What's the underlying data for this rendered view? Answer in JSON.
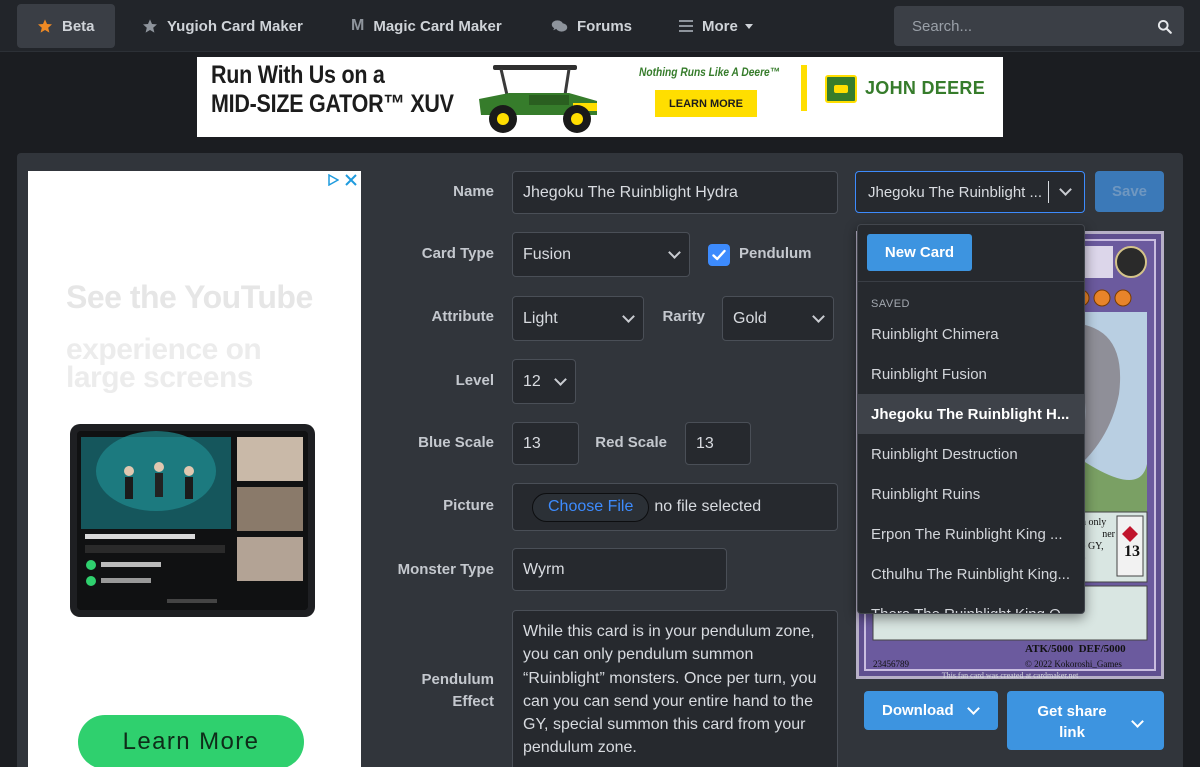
{
  "nav": {
    "items": [
      {
        "label": "Beta",
        "icon": "star-icon"
      },
      {
        "label": "Yugioh Card Maker",
        "icon": "star-icon"
      },
      {
        "label": "Magic Card Maker",
        "icon_glyph": "M"
      },
      {
        "label": "Forums",
        "icon": "comments-icon"
      },
      {
        "label": "More",
        "icon": "hamburger-icon"
      }
    ],
    "search_placeholder": "Search..."
  },
  "banner": {
    "headline_1": "Run With Us on a",
    "headline_2": "MID-SIZE GATOR™ XUV",
    "tagline": "Nothing Runs Like A Deere™",
    "cta": "LEARN MORE",
    "brand": "JOHN DEERE"
  },
  "side_ad": {
    "title_1": "See the YouTube",
    "title_2": "experience on large screens",
    "cta": "Learn More"
  },
  "form": {
    "name_label": "Name",
    "name_value": "Jhegoku The Ruinblight Hydra",
    "card_type_label": "Card Type",
    "card_type_value": "Fusion",
    "pendulum_label": "Pendulum",
    "attribute_label": "Attribute",
    "attribute_value": "Light",
    "rarity_label": "Rarity",
    "rarity_value": "Gold",
    "level_label": "Level",
    "level_value": "12",
    "blue_scale_label": "Blue Scale",
    "blue_scale_value": "13",
    "red_scale_label": "Red Scale",
    "red_scale_value": "13",
    "picture_label": "Picture",
    "choose_file": "Choose File",
    "no_file": "no file selected",
    "monster_type_label": "Monster Type",
    "monster_type_value": "Wyrm",
    "pendulum_effect_label_1": "Pendulum",
    "pendulum_effect_label_2": "Effect",
    "pendulum_effect_value": "While this card is in your pendulum zone, you can only pendulum summon “Ruinblight” monsters. Once per turn, you can you can send your entire hand to the GY, special summon this card from your pendulum zone."
  },
  "card_picker": {
    "selected": "Jhegoku The Ruinblight ...",
    "save_label": "Save",
    "new_card_label": "New Card",
    "saved_header": "SAVED",
    "saved_items": [
      "Ruinblight Chimera",
      "Ruinblight Fusion",
      "Jhegoku The Ruinblight H...",
      "Ruinblight Destruction",
      "Ruinblight Ruins",
      "Erpon The Ruinblight King ...",
      "Cthulhu The Ruinblight King...",
      "Thera The Ruinblight King O..."
    ],
    "active_index": 2
  },
  "card_preview": {
    "pendulum_scale": "13",
    "atk_def": "ATK/5000  DEF/5000",
    "serial": "23456789",
    "copyright": "© 2022 Kokoroshi_Games",
    "caption": "This fan card was created at cardmaker.net",
    "text_fragments": [
      "n only",
      "ner",
      "e GY,",
      "e"
    ]
  },
  "actions": {
    "download_label": "Download",
    "share_label": "Get share link"
  },
  "colors": {
    "accent": "#3d94e0",
    "background": "#1b1d21",
    "panel": "#31353b",
    "input": "#26292e"
  }
}
